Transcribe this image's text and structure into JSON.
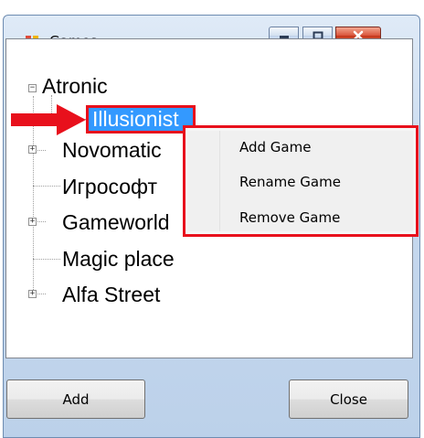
{
  "window": {
    "title": "Games"
  },
  "tree": {
    "nodes": [
      {
        "label": "Atronic",
        "expanded": true
      },
      {
        "label": "Illusionist",
        "selected": true
      },
      {
        "label": "Novomatic",
        "expander": "+"
      },
      {
        "label": "Игрософт"
      },
      {
        "label": "Gameworld",
        "expander": "+"
      },
      {
        "label": "Magic place"
      },
      {
        "label": "Alfa Street",
        "expander": "+"
      }
    ]
  },
  "context_menu": {
    "items": [
      "Add Game",
      "Rename Game",
      "Remove Game"
    ]
  },
  "buttons": {
    "add_label": "Add",
    "close_label": "Close"
  },
  "colors": {
    "selection": "#3399ff",
    "highlight": "#e8101c"
  }
}
